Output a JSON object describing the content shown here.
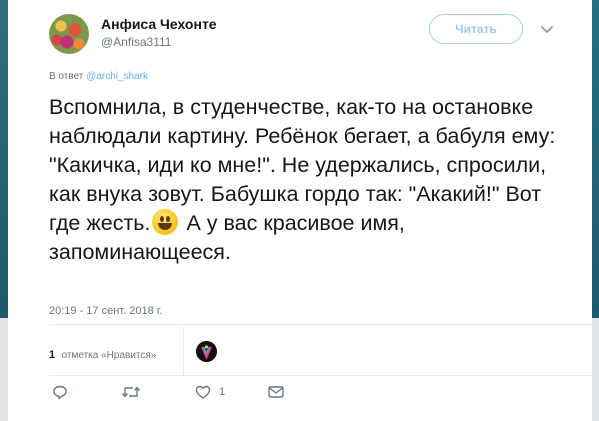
{
  "user": {
    "name": "Анфиса Чехонте",
    "handle": "@Anfisa3111"
  },
  "follow_button": {
    "label": "Читать"
  },
  "reply": {
    "prefix": "В ответ",
    "target": "@archi_shark"
  },
  "tweet": {
    "text_part1": "Вспомнила, в студенчестве, как-то на остановке наблюдали картину. Ребёнок бегает, а бабуля ему: \"Какичка, иди ко мне!\". Не удержались, спросили, как внука зовут. Бабушка гордо так: \"Акакий!\" Вот где жесть.",
    "emoji": "grinning-face",
    "text_part2": " А у вас красивое имя, запоминающееся.",
    "timestamp": "20:19 - 17 сент. 2018 г."
  },
  "likes": {
    "count": "1",
    "label": "отметка «Нравится»"
  },
  "actions": {
    "reply_icon": "reply-icon",
    "retweet_icon": "retweet-icon",
    "like_icon": "heart-icon",
    "like_count": "1",
    "dm_icon": "envelope-icon"
  },
  "colors": {
    "link": "#6aaee8",
    "follow_border": "#9fd1f5",
    "secondary_text": "#657786",
    "background_edge": "#1f5f73"
  }
}
